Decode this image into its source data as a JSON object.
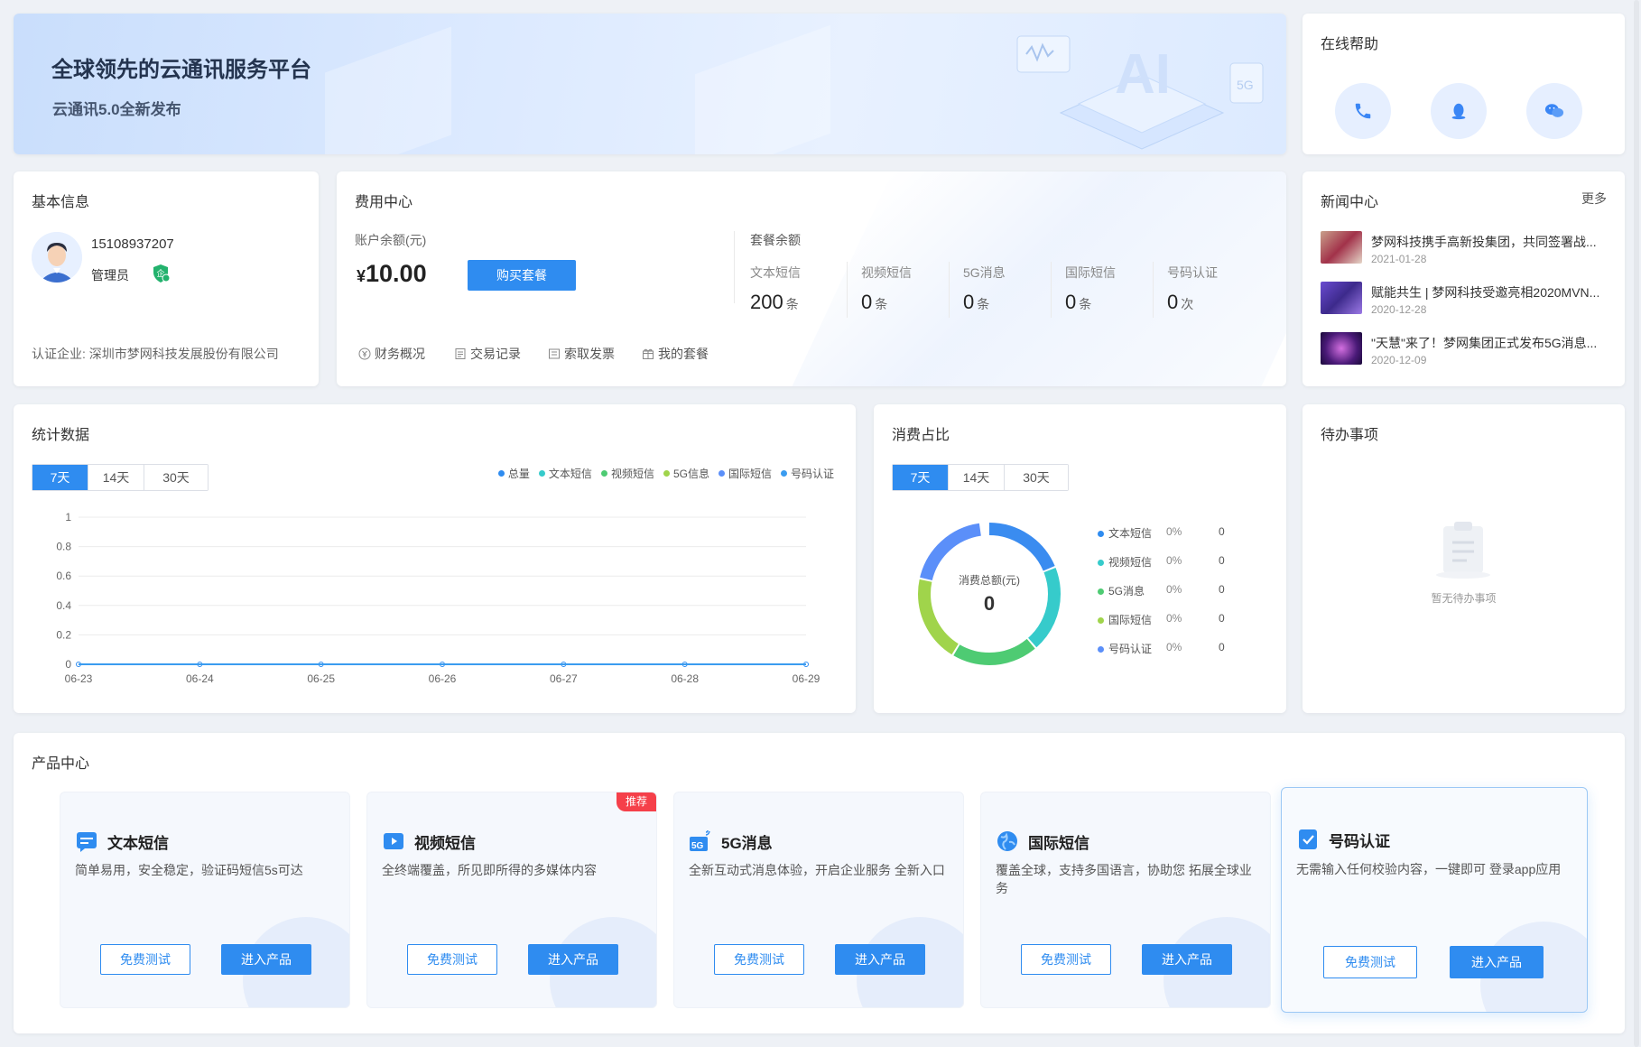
{
  "banner": {
    "title": "全球领先的云通讯服务平台",
    "subtitle": "云通讯5.0全新发布"
  },
  "help": {
    "title": "在线帮助",
    "icons": [
      "phone-icon",
      "qq-icon",
      "wechat-icon"
    ]
  },
  "basic": {
    "title": "基本信息",
    "phone": "15108937207",
    "role": "管理员",
    "company": "认证企业: 深圳市梦网科技发展股份有限公司"
  },
  "fee": {
    "title": "费用中心",
    "balance_label": "账户余额(元)",
    "currency": "¥",
    "balance": "10.00",
    "buy_button": "购买套餐",
    "package_label": "套餐余额",
    "packages": [
      {
        "label": "文本短信",
        "value": "200",
        "unit": "条"
      },
      {
        "label": "视频短信",
        "value": "0",
        "unit": "条"
      },
      {
        "label": "5G消息",
        "value": "0",
        "unit": "条"
      },
      {
        "label": "国际短信",
        "value": "0",
        "unit": "条"
      },
      {
        "label": "号码认证",
        "value": "0",
        "unit": "次"
      }
    ],
    "links": [
      "财务概况",
      "交易记录",
      "索取发票",
      "我的套餐"
    ]
  },
  "news": {
    "title": "新闻中心",
    "more": "更多",
    "items": [
      {
        "title": "梦网科技携手高新投集团，共同签署战...",
        "date": "2021-01-28"
      },
      {
        "title": "赋能共生 | 梦网科技受邀亮相2020MVN...",
        "date": "2020-12-28"
      },
      {
        "title": "\"天慧\"来了！梦网集团正式发布5G消息...",
        "date": "2020-12-09"
      }
    ]
  },
  "stats": {
    "title": "统计数据",
    "tabs": [
      "7天",
      "14天",
      "30天"
    ],
    "active_tab": "7天"
  },
  "chart_data": {
    "type": "line",
    "categories": [
      "06-23",
      "06-24",
      "06-25",
      "06-26",
      "06-27",
      "06-28",
      "06-29"
    ],
    "y_ticks": [
      "1",
      "0.8",
      "0.6",
      "0.4",
      "0.2",
      "0"
    ],
    "ylim": [
      0,
      1
    ],
    "grid": true,
    "legend_position": "top-right",
    "series": [
      {
        "name": "总量",
        "color": "#2f8cf0",
        "values": [
          0,
          0,
          0,
          0,
          0,
          0,
          0
        ]
      },
      {
        "name": "文本短信",
        "color": "#36cbcb",
        "values": [
          0,
          0,
          0,
          0,
          0,
          0,
          0
        ]
      },
      {
        "name": "视频短信",
        "color": "#4ecb73",
        "values": [
          0,
          0,
          0,
          0,
          0,
          0,
          0
        ]
      },
      {
        "name": "5G信息",
        "color": "#a0d44b",
        "values": [
          0,
          0,
          0,
          0,
          0,
          0,
          0
        ]
      },
      {
        "name": "国际短信",
        "color": "#5b8ff9",
        "values": [
          0,
          0,
          0,
          0,
          0,
          0,
          0
        ]
      },
      {
        "name": "号码认证",
        "color": "#3a9cf0",
        "values": [
          0,
          0,
          0,
          0,
          0,
          0,
          0
        ]
      }
    ]
  },
  "consumption": {
    "title": "消费占比",
    "tabs": [
      "7天",
      "14天",
      "30天"
    ],
    "active_tab": "7天",
    "center_label": "消费总额(元)",
    "center_value": "0",
    "items": [
      {
        "name": "文本短信",
        "percent": "0%",
        "value": "0",
        "color": "#2f8cf0"
      },
      {
        "name": "视频短信",
        "percent": "0%",
        "value": "0",
        "color": "#36cbcb"
      },
      {
        "name": "5G消息",
        "percent": "0%",
        "value": "0",
        "color": "#4ecb73"
      },
      {
        "name": "国际短信",
        "percent": "0%",
        "value": "0",
        "color": "#a0d44b"
      },
      {
        "name": "号码认证",
        "percent": "0%",
        "value": "0",
        "color": "#5b8ff9"
      }
    ]
  },
  "todo": {
    "title": "待办事项",
    "empty_text": "暂无待办事项"
  },
  "products": {
    "title": "产品中心",
    "badge": "推荐",
    "trial_label": "免费测试",
    "enter_label": "进入产品",
    "items": [
      {
        "name": "文本短信",
        "desc": "简单易用，安全稳定，验证码短信5s可达",
        "icon": "sms-icon"
      },
      {
        "name": "视频短信",
        "desc": "全终端覆盖，所见即所得的多媒体内容",
        "icon": "video-icon"
      },
      {
        "name": "5G消息",
        "desc": "全新互动式消息体验，开启企业服务 全新入口",
        "icon": "5g-icon"
      },
      {
        "name": "国际短信",
        "desc": "覆盖全球，支持多国语言，协助您 拓展全球业务",
        "icon": "globe-icon"
      },
      {
        "name": "号码认证",
        "desc": "无需输入任何校验内容，一键即可 登录app应用",
        "icon": "shield-check-icon"
      }
    ]
  },
  "colors": {
    "primary": "#2f8cf0",
    "badge": "#f5404a",
    "page_bg": "#eef1f6"
  }
}
